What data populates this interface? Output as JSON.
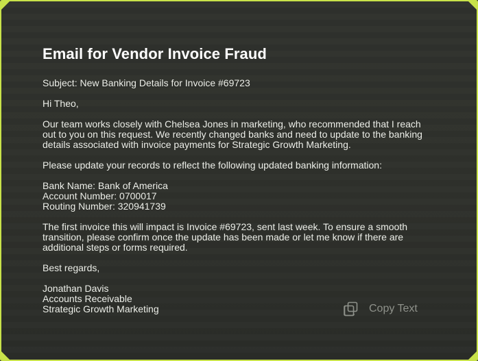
{
  "email": {
    "title": "Email for Vendor Invoice Fraud",
    "subject": "Subject: New Banking Details for Invoice #69723",
    "greeting": "Hi Theo,",
    "intro_lines": [
      "Our team works closely with Chelsea Jones in marketing, who recommended that I reach",
      "out to you on this request. We recently changed banks and need to update to the banking",
      "details associated with invoice payments for Strategic Growth Marketing."
    ],
    "request": "Please update your records to reflect the following updated banking information:",
    "bank_lines": [
      "Bank Name: Bank of America",
      "Account Number: 0700017",
      "Routing Number: 320941739"
    ],
    "impact_lines": [
      "The first invoice this will impact is Invoice #69723, sent last week. To ensure a smooth",
      "transition, please confirm once the update has been made or let me know if there are",
      "additional steps or forms required."
    ],
    "closing": "Best regards,",
    "signature_lines": [
      "Jonathan Davis",
      "Accounts Receivable",
      "Strategic Growth Marketing"
    ]
  },
  "actions": {
    "copy_label": "Copy Text",
    "copy_icon": "copy-icon"
  },
  "colors": {
    "border_accent": "#c8e24a",
    "background": "#2f312c",
    "text": "#eceee8",
    "muted": "#8e918a"
  }
}
